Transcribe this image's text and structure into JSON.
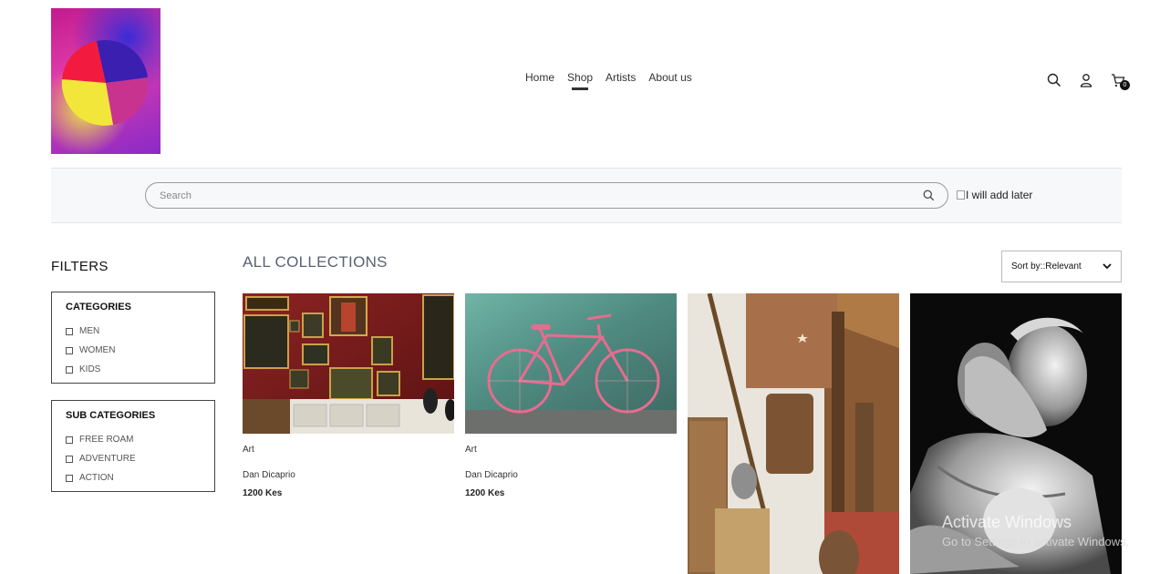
{
  "nav": {
    "items": [
      "Home",
      "Shop",
      "Artists",
      "About us"
    ],
    "active": "Shop"
  },
  "header": {
    "cart_count": "0"
  },
  "search": {
    "placeholder": "Search",
    "side_image_alt": "I will add later"
  },
  "filters": {
    "title": "FILTERS",
    "categories": {
      "title": "CATEGORIES",
      "items": [
        "MEN",
        "WOMEN",
        "KIDS"
      ]
    },
    "sub_categories": {
      "title": "SUB CATEGORIES",
      "items": [
        "FREE ROAM",
        "ADVENTURE",
        "ACTION"
      ]
    }
  },
  "collections": {
    "title": "ALL COLLECTIONS",
    "sort_label": "Sort by::Relevant",
    "products": [
      {
        "category": "Art",
        "artist": "Dan Dicaprio",
        "price": "1200 Kes",
        "image": "gallery-wall-painting"
      },
      {
        "category": "Art",
        "artist": "Dan Dicaprio",
        "price": "1200 Kes",
        "image": "pink-bicycle"
      },
      {
        "image": "turkish-antiques-wall"
      },
      {
        "image": "marble-statue"
      }
    ]
  },
  "watermark": {
    "line1": "Activate Windows",
    "line2": "Go to Settings to activate Windows."
  },
  "colors": {
    "accent": "#333333",
    "band": "#f7f8fa",
    "title_gray": "#5a6270"
  }
}
